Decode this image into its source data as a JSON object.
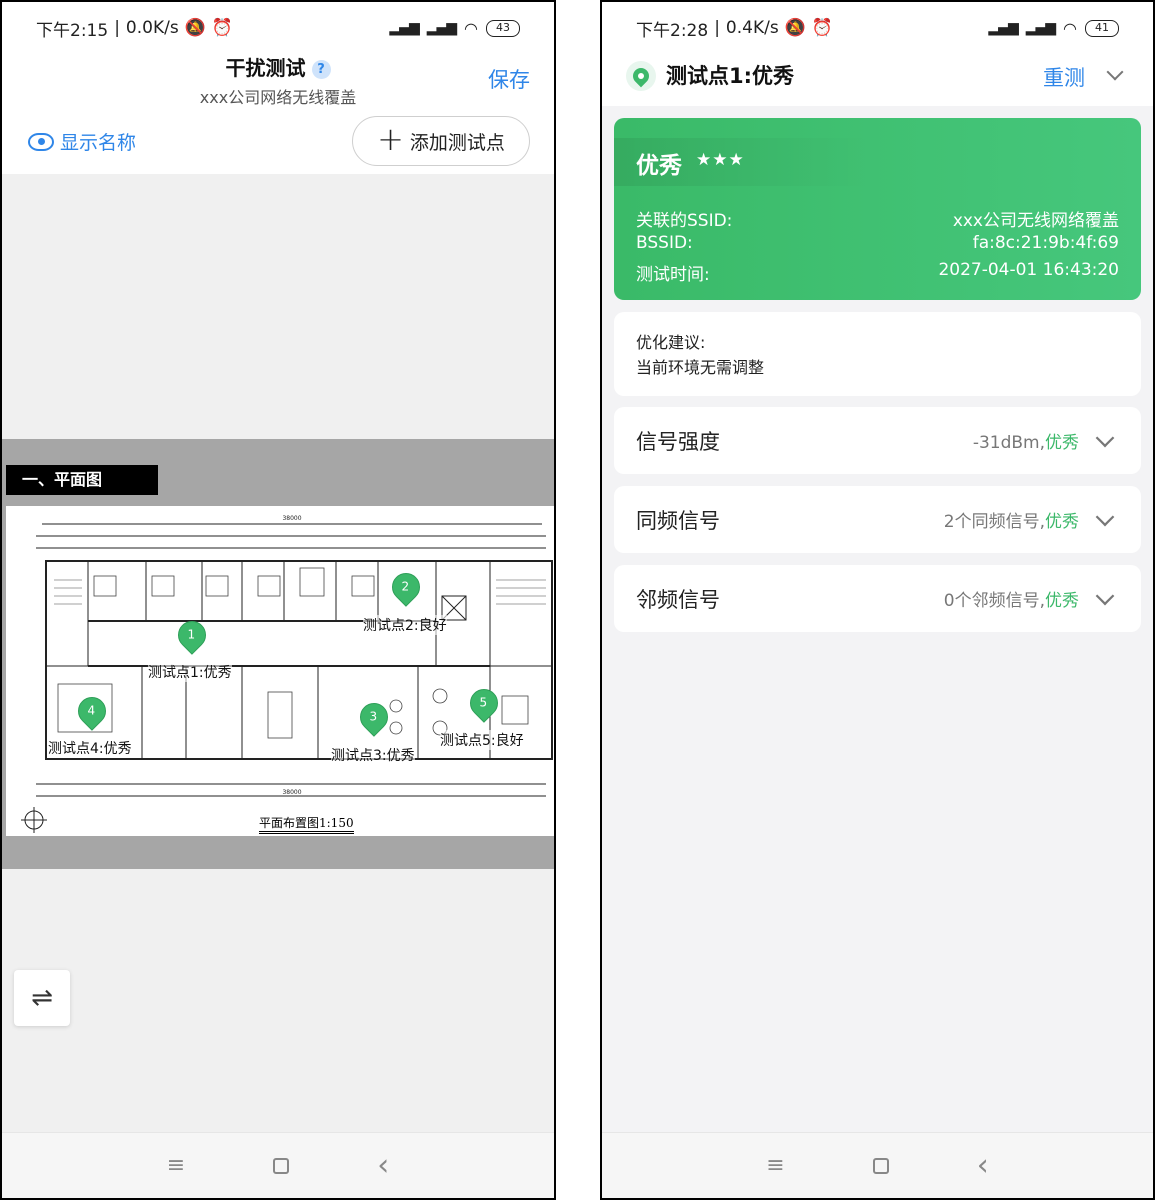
{
  "left": {
    "status": {
      "time": "下午2:15",
      "speed": "0.0K/s",
      "battery": "43"
    },
    "header": {
      "title": "干扰测试",
      "help": "?",
      "subtitle": "xxx公司网络无线覆盖",
      "save": "保存"
    },
    "toolbar": {
      "show_name": "显示名称",
      "add_point": "添加测试点"
    },
    "plan": {
      "heading": "一、平面图",
      "caption": "平面布置图1:150",
      "dim_top": "38000",
      "dim_bottom": "38000",
      "points": [
        {
          "num": "1",
          "label": "测试点1:优秀"
        },
        {
          "num": "2",
          "label": "测试点2:良好"
        },
        {
          "num": "3",
          "label": "测试点3:优秀"
        },
        {
          "num": "4",
          "label": "测试点4:优秀"
        },
        {
          "num": "5",
          "label": "测试点5:良好"
        }
      ]
    },
    "switch_icon": "⇌"
  },
  "right": {
    "status": {
      "time": "下午2:28",
      "speed": "0.4K/s",
      "battery": "41"
    },
    "header": {
      "title": "测试点1:优秀",
      "retest": "重测"
    },
    "result": {
      "grade": "优秀",
      "stars": "★★★",
      "rows": [
        {
          "label": "关联的SSID:",
          "value": "xxx公司无线网络覆盖"
        },
        {
          "label": "BSSID:",
          "value": "fa:8c:21:9b:4f:69"
        },
        {
          "label": "测试时间:",
          "value": "2027-04-01 16:43:20"
        }
      ]
    },
    "advice": {
      "title": "优化建议:",
      "text": "当前环境无需调整"
    },
    "metrics": [
      {
        "label": "信号强度",
        "value": "-31dBm,",
        "grade": "优秀"
      },
      {
        "label": "同频信号",
        "value": "2个同频信号,",
        "grade": "优秀"
      },
      {
        "label": "邻频信号",
        "value": "0个邻频信号,",
        "grade": "优秀"
      }
    ]
  },
  "nav": {
    "menu": "≡",
    "back": "‹"
  },
  "colors": {
    "accent": "#2f86e8",
    "good": "#3cb86a"
  }
}
